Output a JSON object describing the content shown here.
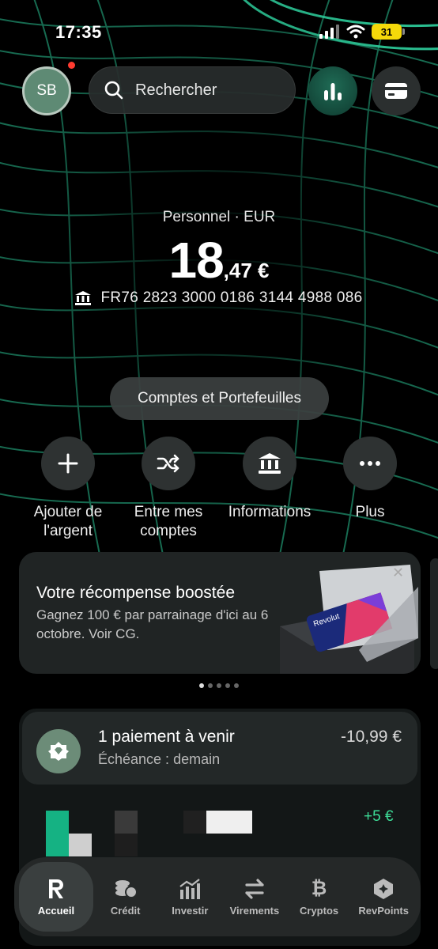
{
  "status_bar": {
    "time": "17:35",
    "battery": "31"
  },
  "header": {
    "avatar_initials": "SB",
    "search_placeholder": "Rechercher"
  },
  "account": {
    "label": "Personnel · EUR",
    "balance_int": "18",
    "balance_dec": ",47 €",
    "iban": "FR76 2823 3000 0186 3144 4988 086"
  },
  "accounts_button": "Comptes et Portefeuilles",
  "actions": [
    {
      "label": "Ajouter de l'argent",
      "icon": "plus-icon"
    },
    {
      "label": "Entre mes comptes",
      "icon": "shuffle-icon"
    },
    {
      "label": "Informations",
      "icon": "bank-icon"
    },
    {
      "label": "Plus",
      "icon": "more-icon"
    }
  ],
  "promo": {
    "title": "Votre récompense boostée",
    "body": "Gagnez 100 € par parrainage d'ici au 6 octobre. Voir CG.",
    "card_brand": "Revolut"
  },
  "upcoming": {
    "title": "1 paiement à venir",
    "subtitle": "Échéance : demain",
    "amount": "-10,99 €"
  },
  "transaction": {
    "amount": "+5 €"
  },
  "nav": [
    {
      "label": "Accueil",
      "icon": "revolut-r-icon",
      "active": true
    },
    {
      "label": "Crédit",
      "icon": "coins-icon"
    },
    {
      "label": "Investir",
      "icon": "chart-icon"
    },
    {
      "label": "Virements",
      "icon": "transfer-icon"
    },
    {
      "label": "Cryptos",
      "icon": "bitcoin-icon"
    },
    {
      "label": "RevPoints",
      "icon": "revpoints-icon"
    }
  ],
  "colors": {
    "accent": "#1fb98a",
    "positive": "#3ddc97",
    "background": "#000000"
  }
}
